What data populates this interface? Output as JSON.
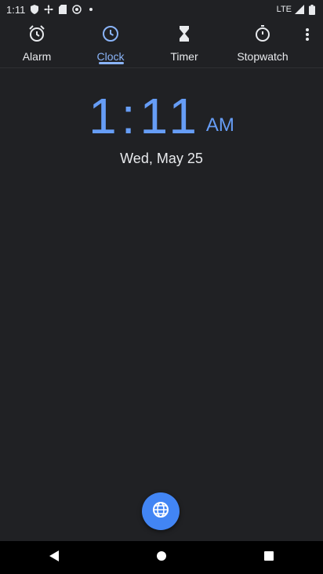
{
  "status_bar": {
    "time": "1:11",
    "network": "LTE",
    "icons": [
      "shield-icon",
      "fan-icon",
      "sd-card-icon",
      "radio-icon",
      "dot-icon"
    ]
  },
  "tabs": [
    {
      "label": "Alarm",
      "icon": "alarm-icon",
      "active": false
    },
    {
      "label": "Clock",
      "icon": "clock-icon",
      "active": true
    },
    {
      "label": "Timer",
      "icon": "hourglass-icon",
      "active": false
    },
    {
      "label": "Stopwatch",
      "icon": "stopwatch-icon",
      "active": false
    }
  ],
  "clock": {
    "time": "1:11",
    "ampm": "AM",
    "date": "Wed, May 25"
  },
  "fab": {
    "icon": "globe-icon"
  },
  "colors": {
    "accent": "#8ab4f8",
    "time": "#669df6",
    "fab": "#4285f4",
    "background": "#202124"
  }
}
